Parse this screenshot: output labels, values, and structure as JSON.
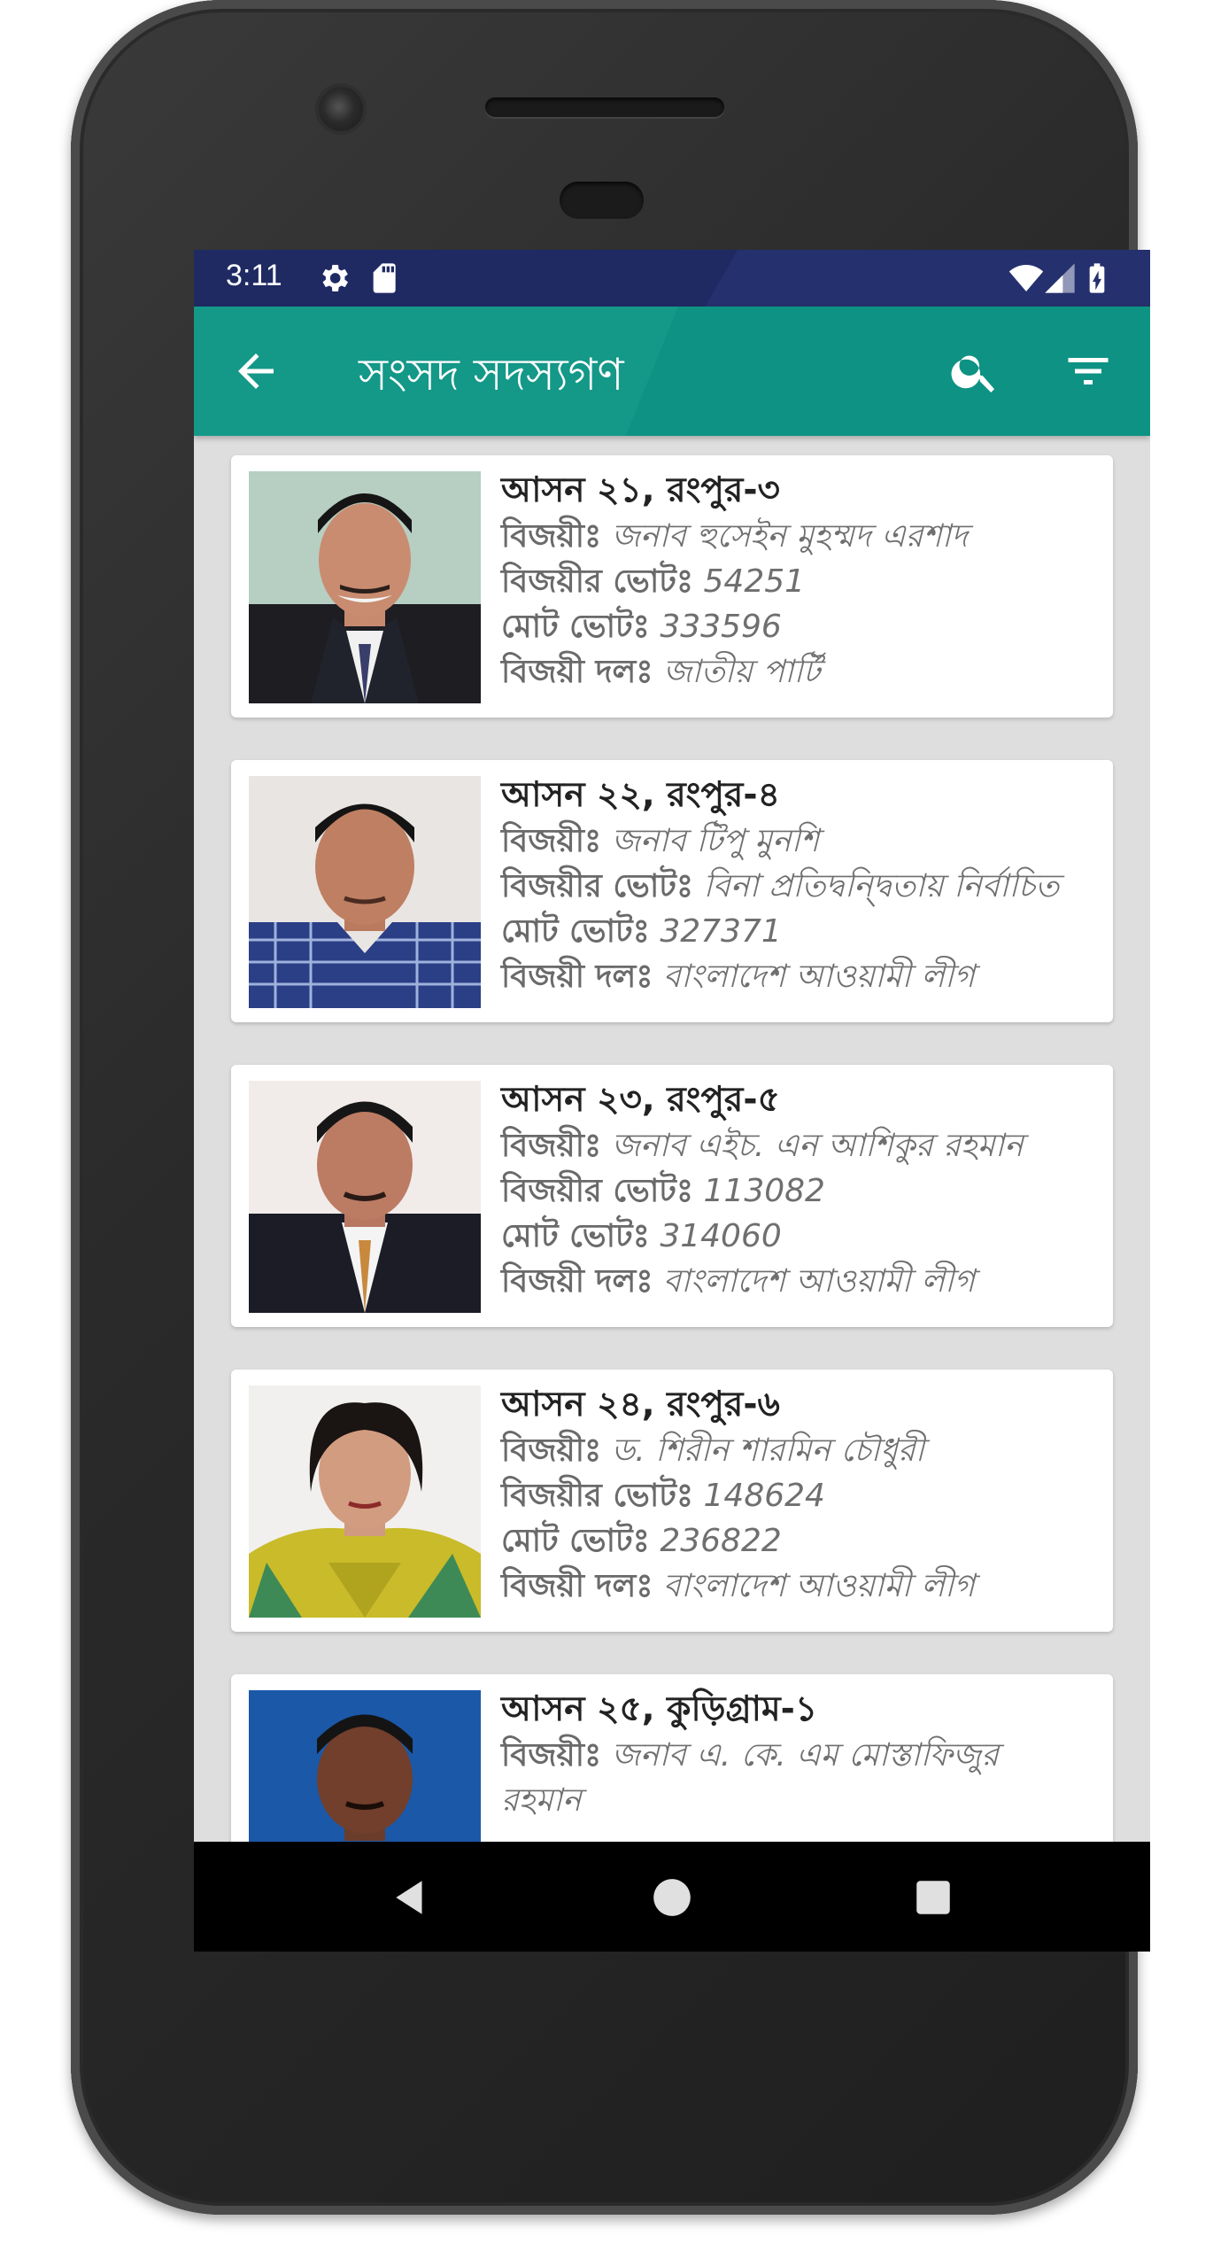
{
  "status_bar": {
    "time": "3:11",
    "icons": [
      "gear-icon",
      "sd-card-icon",
      "wifi-icon",
      "signal-icon",
      "battery-charging-icon"
    ]
  },
  "app_bar": {
    "title": "সংসদ সদস্যগণ",
    "back_icon": "arrow-back-icon",
    "search_icon": "search-icon",
    "filter_icon": "filter-icon"
  },
  "labels": {
    "winner": "বিজয়ীঃ",
    "winner_votes": "বিজয়ীর ভোটঃ",
    "total_votes": "মোট ভোটঃ",
    "winner_party": "বিজয়ী দলঃ"
  },
  "members": [
    {
      "seat": "আসন ২১, রংপুর-৩",
      "winner": "জনাব হুসেইন মুহম্মদ এরশাদ",
      "winner_votes": "54251",
      "total_votes": "333596",
      "party": "জাতীয় পার্টি"
    },
    {
      "seat": "আসন ২২, রংপুর-৪",
      "winner": "জনাব টিপু মুনশি",
      "winner_votes": "বিনা প্রতিদ্বন্দ্বিতায় নির্বাচিত",
      "total_votes": "327371",
      "party": "বাংলাদেশ আওয়ামী লীগ"
    },
    {
      "seat": "আসন ২৩, রংপুর-৫",
      "winner": "জনাব এইচ. এন আশিকুর রহমান",
      "winner_votes": "113082",
      "total_votes": "314060",
      "party": "বাংলাদেশ আওয়ামী লীগ"
    },
    {
      "seat": "আসন ২৪, রংপুর-৬",
      "winner": "ড. শিরীন শারমিন চৌধুরী",
      "winner_votes": "148624",
      "total_votes": "236822",
      "party": "বাংলাদেশ আওয়ামী লীগ"
    },
    {
      "seat": "আসন ২৫, কুড়িগ্রাম-১",
      "winner": "জনাব এ. কে. এম মোস্তাফিজুর",
      "winner_cont": "রহমান",
      "winner_votes": "",
      "total_votes": "",
      "party": ""
    }
  ],
  "nav_bar": {
    "back": "nav-back-icon",
    "home": "nav-home-icon",
    "recents": "nav-recents-icon"
  }
}
